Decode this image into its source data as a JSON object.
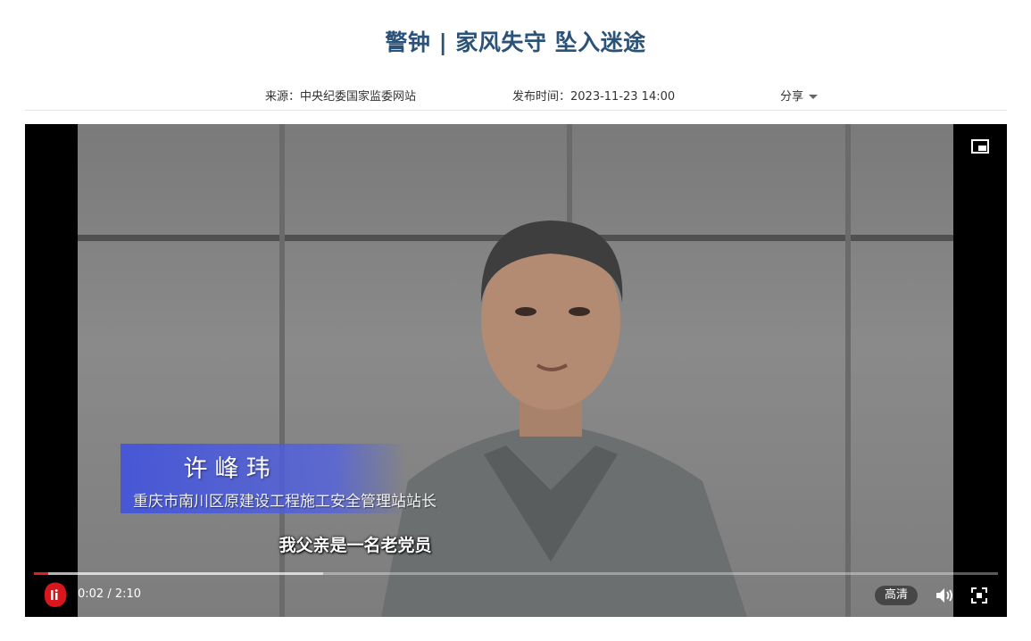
{
  "article": {
    "title": "警钟 | 家风失守 坠入迷途",
    "source": "来源：中央纪委国家监委网站",
    "publish_time": "发布时间：2023-11-23 14:00",
    "share_label": "分享"
  },
  "video": {
    "name_caption": "许峰玮",
    "role_caption": "重庆市南川区原建设工程施工安全管理站站长",
    "subtitle": "我父亲是一名老党员",
    "time_display": "0:02 / 2:10",
    "quality_label": "高清",
    "progress_fraction": 0.015,
    "buffered_fraction": 0.3,
    "accent_color": "#e02020",
    "icons": [
      "play-logo-icon",
      "pip-icon",
      "volume-icon",
      "fullscreen-icon"
    ]
  },
  "colors": {
    "title": "#2b5278",
    "caption_band": "#4254dc"
  }
}
